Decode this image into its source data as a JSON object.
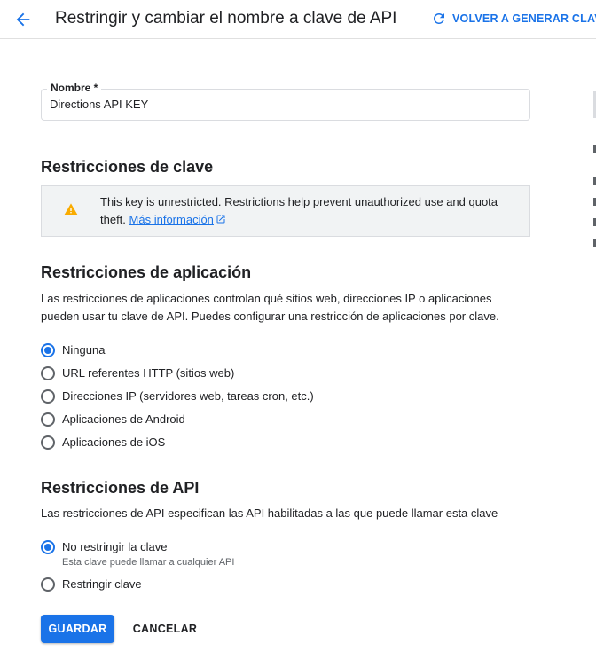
{
  "header": {
    "title": "Restringir y cambiar el nombre a clave de API",
    "regenerate_label": "VOLVER A GENERAR CLAVE"
  },
  "name_field": {
    "label": "Nombre *",
    "value": "Directions API KEY"
  },
  "key_restrictions": {
    "heading": "Restricciones de clave",
    "warning_text": "This key is unrestricted. Restrictions help prevent unauthorized use and quota theft.",
    "learn_more": "Más información"
  },
  "app_restrictions": {
    "heading": "Restricciones de aplicación",
    "description": "Las restricciones de aplicaciones controlan qué sitios web, direcciones IP o aplicaciones pueden usar tu clave de API. Puedes configurar una restricción de aplicaciones por clave.",
    "options": [
      {
        "label": "Ninguna",
        "selected": true
      },
      {
        "label": "URL referentes HTTP (sitios web)",
        "selected": false
      },
      {
        "label": "Direcciones IP (servidores web, tareas cron, etc.)",
        "selected": false
      },
      {
        "label": "Aplicaciones de Android",
        "selected": false
      },
      {
        "label": "Aplicaciones de iOS",
        "selected": false
      }
    ]
  },
  "api_restrictions": {
    "heading": "Restricciones de API",
    "description": "Las restricciones de API especifican las API habilitadas a las que puede llamar esta clave",
    "options": [
      {
        "label": "No restringir la clave",
        "sublabel": "Esta clave puede llamar a cualquier API",
        "selected": true
      },
      {
        "label": "Restringir clave",
        "selected": false
      }
    ]
  },
  "actions": {
    "save": "GUARDAR",
    "cancel": "CANCELAR"
  },
  "colors": {
    "accent": "#1a73e8",
    "warning": "#f9ab00",
    "text": "#202124"
  },
  "icons": [
    "back-arrow-icon",
    "refresh-icon",
    "warning-icon",
    "open-in-new-icon"
  ]
}
